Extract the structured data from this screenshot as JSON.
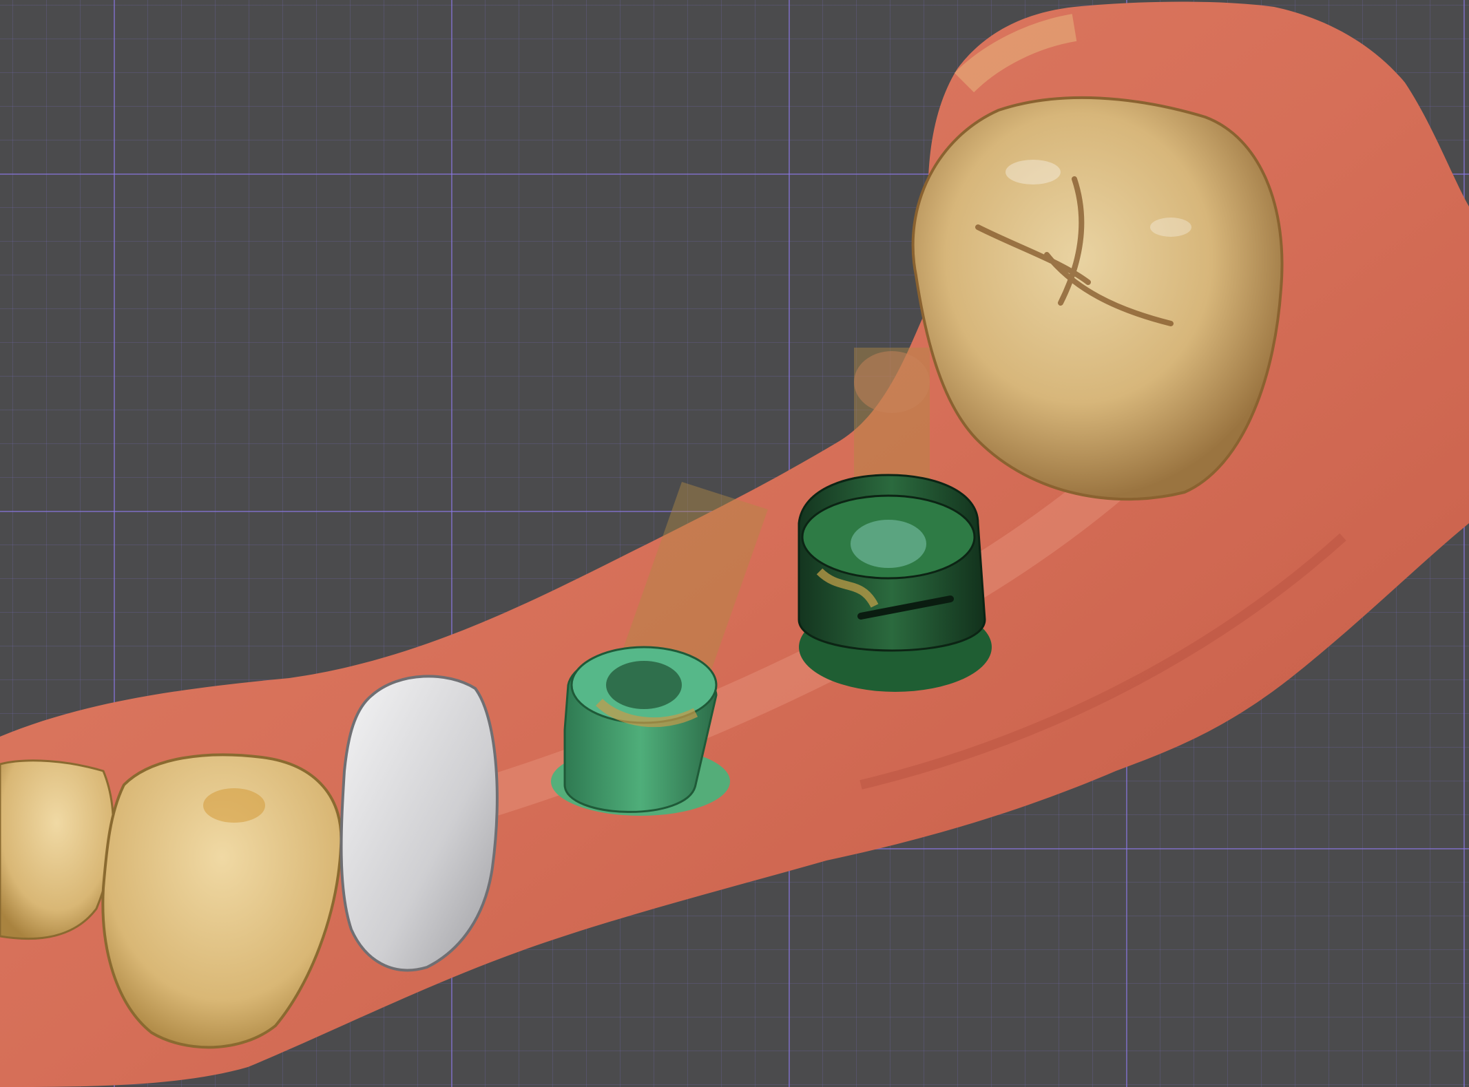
{
  "viewport": {
    "grid_color": "#7a6bd6",
    "background_color": "#4b4b4d"
  },
  "colors": {
    "gingiva": "#d9735c",
    "gingiva_shadow": "#b85240",
    "tooth": "#d8b878",
    "crown_prep": "#d9d9db",
    "scan_body_light": "#3f9a6a",
    "scan_body_dark": "#1e4d2e",
    "implant_axis": "#b28a45"
  },
  "objects": [
    {
      "name": "lower-arch-gingiva-scan"
    },
    {
      "name": "molar-tooth"
    },
    {
      "name": "premolar-tooth-left"
    },
    {
      "name": "premolar-tooth-far-left"
    },
    {
      "name": "prepared-abutment-gray"
    },
    {
      "name": "scan-body-anterior"
    },
    {
      "name": "scan-body-posterior"
    },
    {
      "name": "implant-axis-anterior"
    },
    {
      "name": "implant-axis-posterior"
    }
  ]
}
